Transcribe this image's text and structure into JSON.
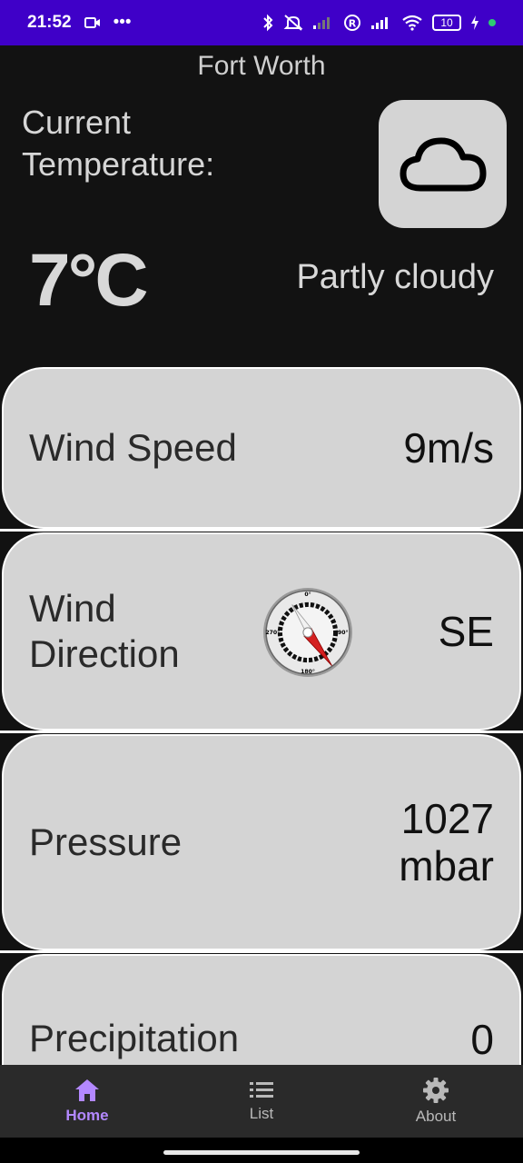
{
  "status_bar": {
    "time": "21:52",
    "battery": "10"
  },
  "header": {
    "city": "Fort Worth",
    "current_label": "Current Temperature:",
    "temperature": "7°C",
    "condition": "Partly cloudy",
    "weather_icon": "cloud-icon"
  },
  "cards": {
    "wind_speed": {
      "label": "Wind Speed",
      "value": "9m/s"
    },
    "wind_direction": {
      "label_line1": "Wind",
      "label_line2": "Direction",
      "value": "SE",
      "compass_marks": [
        "0°",
        "90°",
        "180°",
        "270°"
      ]
    },
    "pressure": {
      "label": "Pressure",
      "value_line1": "1027",
      "value_line2": "mbar"
    },
    "precipitation": {
      "label": "Precipitation",
      "value": "0"
    }
  },
  "nav": {
    "items": [
      {
        "label": "Home",
        "icon": "home-icon"
      },
      {
        "label": "List",
        "icon": "list-icon"
      },
      {
        "label": "About",
        "icon": "gear-icon"
      }
    ],
    "active_color": "#b388ff"
  },
  "colors": {
    "status_bar": "#3f00c8",
    "background": "#121212",
    "card": "#d4d4d4"
  }
}
